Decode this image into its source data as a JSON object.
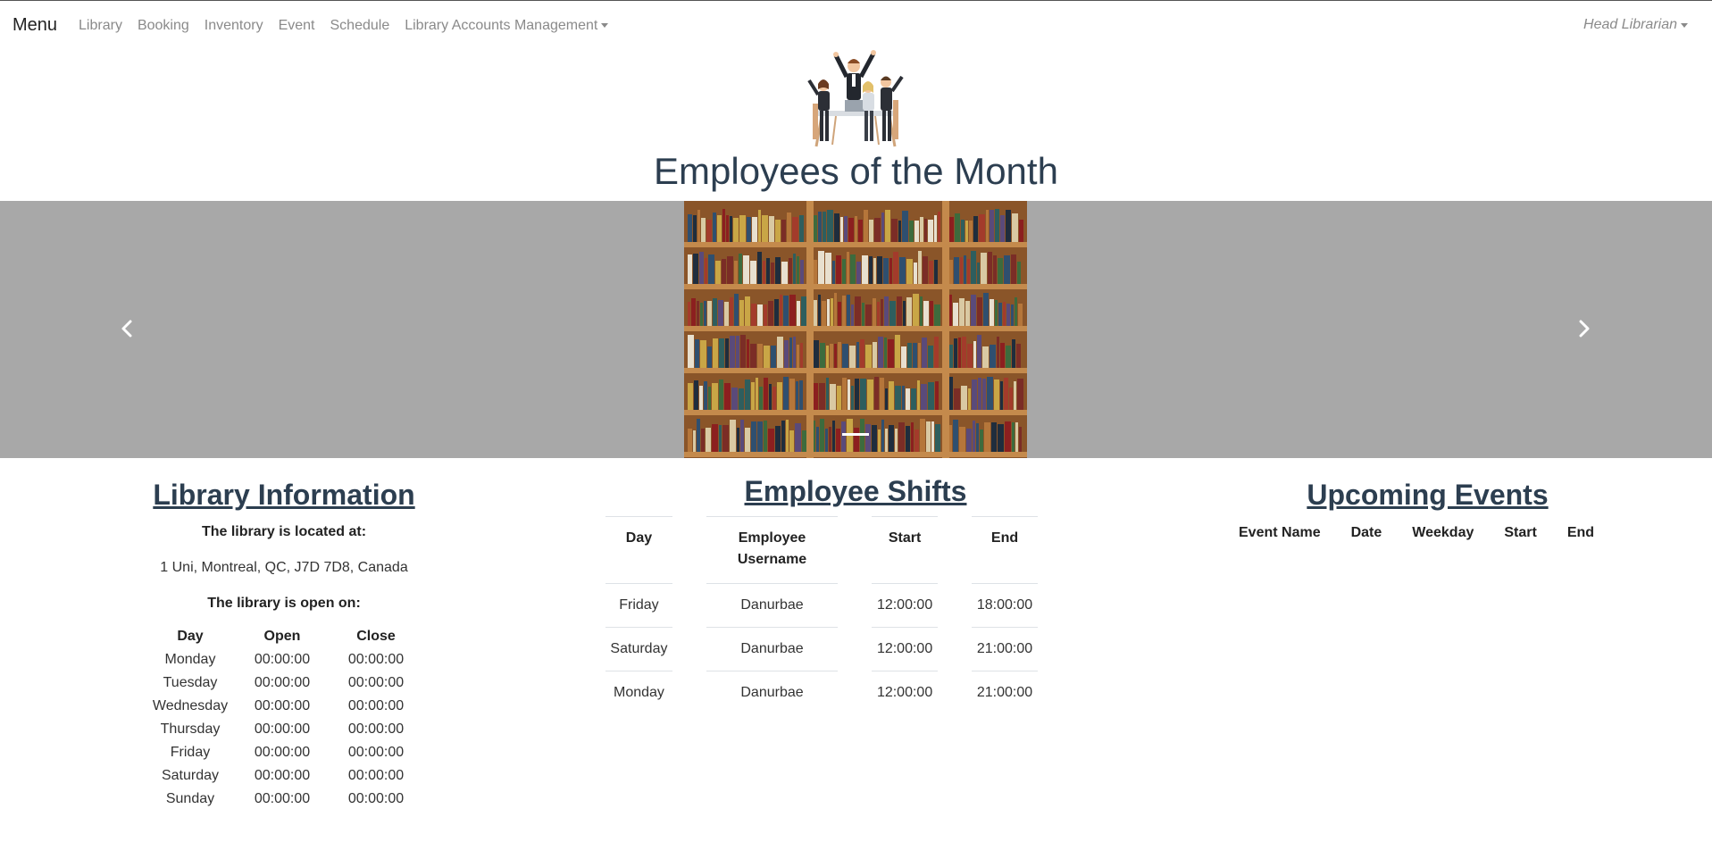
{
  "navbar": {
    "brand": "Menu",
    "items": [
      {
        "label": "Library"
      },
      {
        "label": "Booking"
      },
      {
        "label": "Inventory"
      },
      {
        "label": "Event"
      },
      {
        "label": "Schedule"
      },
      {
        "label": "Library Accounts Management"
      }
    ],
    "user": "Head Librarian"
  },
  "header": {
    "title": "Employees of the Month"
  },
  "carousel": {
    "prev_icon": "chevron-left-icon",
    "next_icon": "chevron-right-icon",
    "slide_count": 1,
    "active_index": 0
  },
  "library_info": {
    "title": "Library Information",
    "located_label": "The library is located at:",
    "address": "1 Uni, Montreal, QC, J7D 7D8, Canada",
    "open_label": "The library is open on:",
    "columns": [
      "Day",
      "Open",
      "Close"
    ],
    "rows": [
      [
        "Monday",
        "00:00:00",
        "00:00:00"
      ],
      [
        "Tuesday",
        "00:00:00",
        "00:00:00"
      ],
      [
        "Wednesday",
        "00:00:00",
        "00:00:00"
      ],
      [
        "Thursday",
        "00:00:00",
        "00:00:00"
      ],
      [
        "Friday",
        "00:00:00",
        "00:00:00"
      ],
      [
        "Saturday",
        "00:00:00",
        "00:00:00"
      ],
      [
        "Sunday",
        "00:00:00",
        "00:00:00"
      ]
    ]
  },
  "shifts": {
    "title": "Employee Shifts",
    "columns": [
      "Day",
      "Employee Username",
      "Start",
      "End"
    ],
    "rows": [
      [
        "Friday",
        "Danurbae",
        "12:00:00",
        "18:00:00"
      ],
      [
        "Saturday",
        "Danurbae",
        "12:00:00",
        "21:00:00"
      ],
      [
        "Monday",
        "Danurbae",
        "12:00:00",
        "21:00:00"
      ]
    ]
  },
  "events": {
    "title": "Upcoming Events",
    "columns": [
      "Event Name",
      "Date",
      "Weekday",
      "Start",
      "End"
    ]
  }
}
